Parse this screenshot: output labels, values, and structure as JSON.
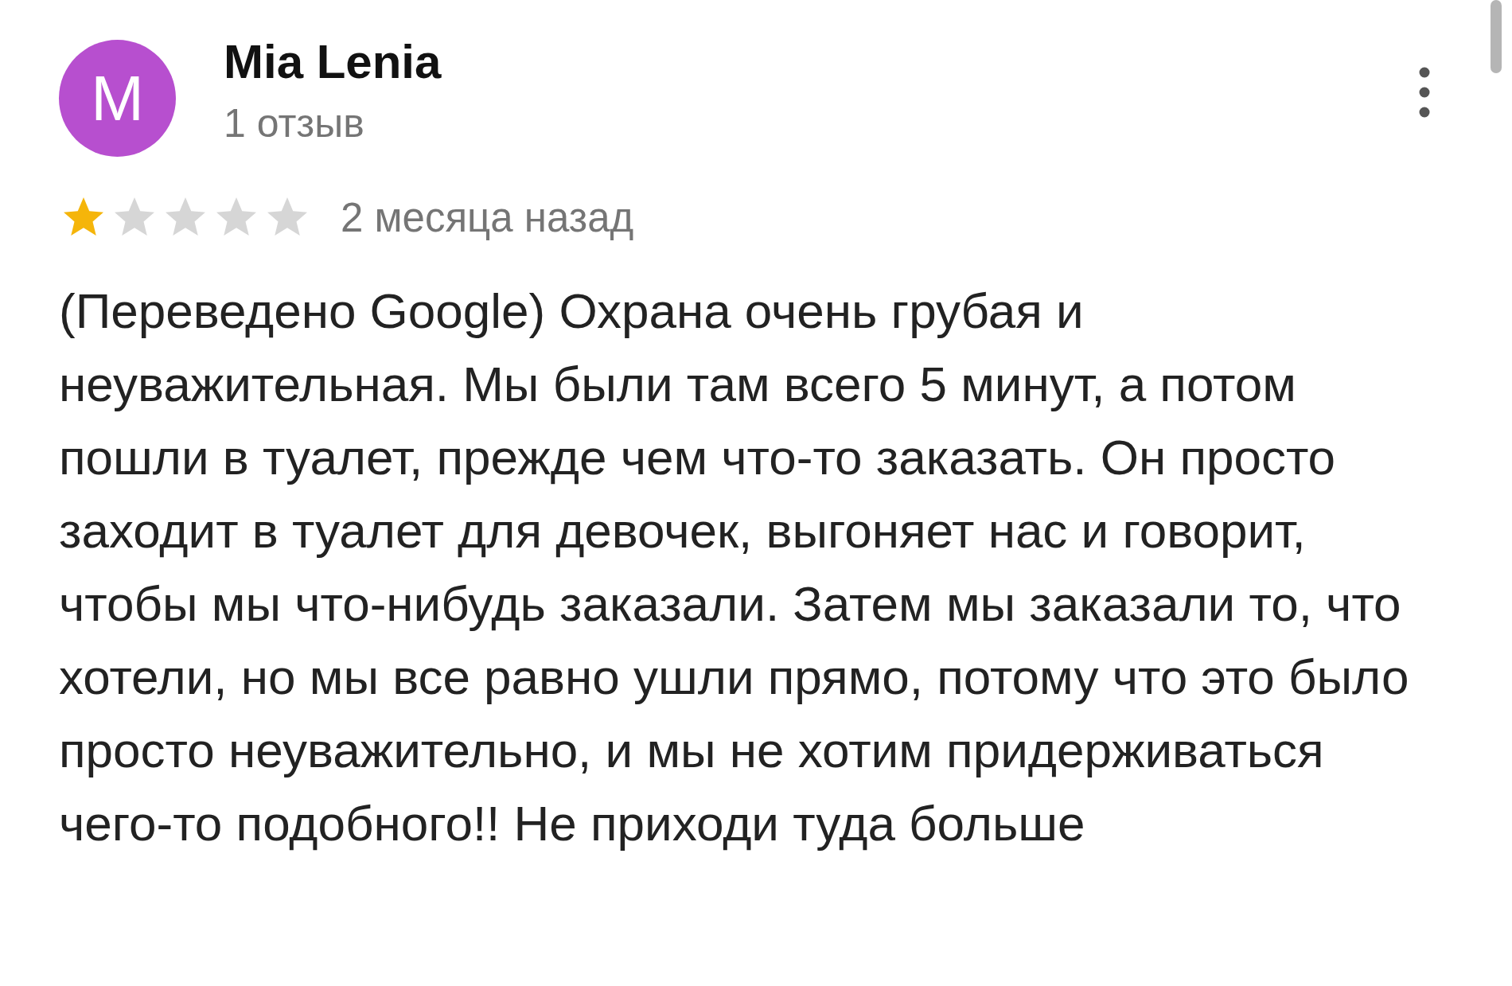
{
  "review": {
    "avatar_letter": "M",
    "color": "#b74fcf",
    "name": "Mia Lenia",
    "review_count": "1 отзыв",
    "stars": 1,
    "date": "2 месяца назад",
    "text": "(Переведено Google) Охрана очень грубая и неуважительная. Мы были там всего 5 минут, а потом пошли в туалет, прежде чем что-то заказать. Он просто заходит в туалет для девочек, выгоняет нас и говорит, чтобы мы что-нибудь заказали. Затем мы заказали то, что хотели, но мы все равно ушли прямо, потому что это было просто неуважительно, и мы не хотим придерживаться чего-то подобного!! Не приходи туда больше"
  }
}
